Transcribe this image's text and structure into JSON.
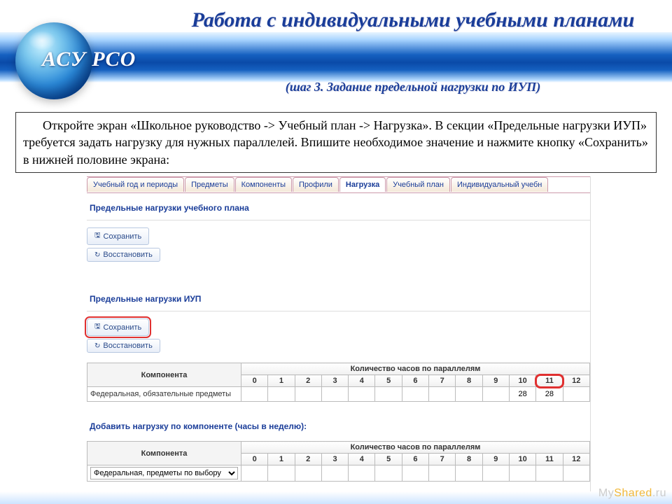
{
  "header": {
    "logo_text": "АСУ РСО",
    "title": "Работа с индивидуальными учебными планами",
    "subtitle": "(шаг 3. Задание предельной нагрузки по ИУП)"
  },
  "instruction": "Откройте экран «Школьное руководство -> Учебный план -> Нагрузка». В секции «Предельные нагрузки ИУП» требуется задать нагрузку для нужных параллелей. Впишите необходимое значение и нажмите кнопку «Сохранить» в нижней половине экрана:",
  "tabs": [
    {
      "label": "Учебный год и периоды",
      "active": false
    },
    {
      "label": "Предметы",
      "active": false
    },
    {
      "label": "Компоненты",
      "active": false
    },
    {
      "label": "Профили",
      "active": false
    },
    {
      "label": "Нагрузка",
      "active": true
    },
    {
      "label": "Учебный план",
      "active": false
    },
    {
      "label": "Индивидуальный учебн",
      "active": false
    }
  ],
  "section1": {
    "title": "Предельные нагрузки учебного плана",
    "save": "Сохранить",
    "restore": "Восстановить"
  },
  "section2": {
    "title": "Предельные нагрузки ИУП",
    "save": "Сохранить",
    "restore": "Восстановить",
    "table": {
      "component_header": "Компонента",
      "hours_header": "Количество часов по параллелям",
      "cols": [
        "0",
        "1",
        "2",
        "3",
        "4",
        "5",
        "6",
        "7",
        "8",
        "9",
        "10",
        "11",
        "12"
      ],
      "row_label": "Федеральная, обязательные предметы",
      "values": [
        "",
        "",
        "",
        "",
        "",
        "",
        "",
        "",
        "",
        "",
        "28",
        "28",
        ""
      ],
      "highlight_col": 11
    }
  },
  "section3": {
    "title": "Добавить нагрузку по компоненте (часы в неделю):",
    "table": {
      "component_header": "Компонента",
      "hours_header": "Количество часов по параллелям",
      "cols": [
        "0",
        "1",
        "2",
        "3",
        "4",
        "5",
        "6",
        "7",
        "8",
        "9",
        "10",
        "11",
        "12"
      ],
      "select_value": "Федеральная, предметы по выбору"
    }
  },
  "watermark": {
    "pre": "My",
    "accent": "Shared",
    "post": ".ru"
  }
}
